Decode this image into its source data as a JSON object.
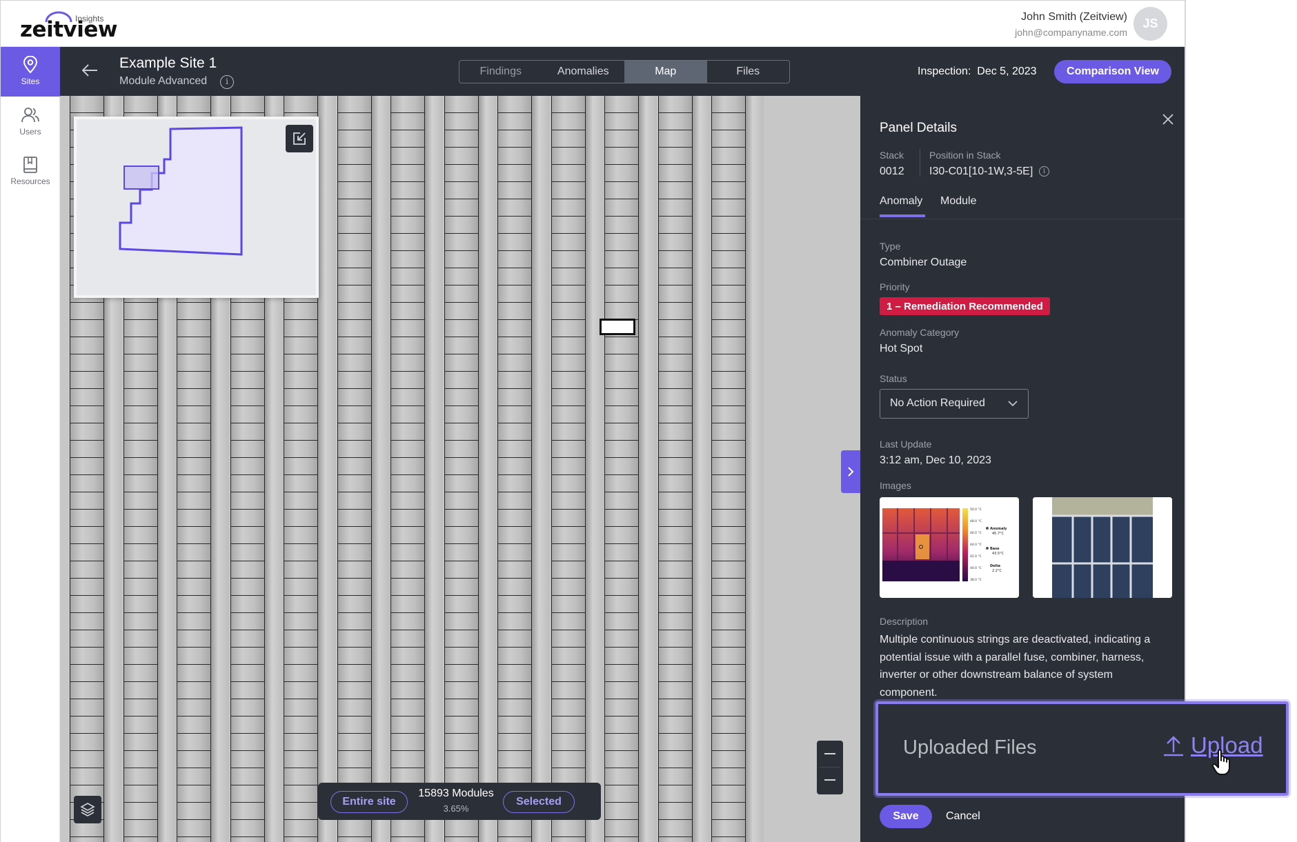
{
  "brand": {
    "name": "zeitview",
    "subtitle": "Insights"
  },
  "user": {
    "name": "John Smith (Zeitview)",
    "email": "john@companyname.com",
    "initials": "JS"
  },
  "nav": {
    "items": [
      {
        "label": "Sites",
        "icon": "location-pin-icon",
        "active": true
      },
      {
        "label": "Users",
        "icon": "users-icon",
        "active": false
      },
      {
        "label": "Resources",
        "icon": "book-icon",
        "active": false
      }
    ]
  },
  "header": {
    "site_title": "Example Site 1",
    "site_subtitle": "Module Advanced",
    "tabs": [
      {
        "label": "Findings",
        "active": false
      },
      {
        "label": "Anomalies",
        "active": false
      },
      {
        "label": "Map",
        "active": true
      },
      {
        "label": "Files",
        "active": false
      }
    ],
    "inspection_label": "Inspection:",
    "inspection_date": "Dec 5, 2023",
    "comparison_button": "Comparison View"
  },
  "map": {
    "module_count": "15893 Modules",
    "module_percent": "3.65%",
    "entire_site_label": "Entire site",
    "selected_label": "Selected"
  },
  "panel": {
    "title": "Panel Details",
    "stack_label": "Stack",
    "stack_value": "0012",
    "position_label": "Position in Stack",
    "position_value": "I30-C01[10-1W,3-5E]",
    "tabs": [
      {
        "label": "Anomaly",
        "active": true
      },
      {
        "label": "Module",
        "active": false
      }
    ],
    "type_label": "Type",
    "type_value": "Combiner Outage",
    "priority_label": "Priority",
    "priority_value": "1 – Remediation Recommended",
    "category_label": "Anomaly Category",
    "category_value": "Hot Spot",
    "status_label": "Status",
    "status_value": "No Action Required",
    "last_update_label": "Last Update",
    "last_update_value": "3:12 am, Dec 10, 2023",
    "images_label": "Images",
    "thermal_scale": [
      "50.0 °C",
      "48.0 °C",
      "46.0 °C",
      "44.0 °C",
      "42.0 °C",
      "40.0 °C",
      "38.0 °C"
    ],
    "thermal_legend": {
      "anomaly_label": "Anomaly",
      "anomaly_value": "45.7°C",
      "base_label": "Base",
      "base_value": "43.5°C",
      "delta_label": "Delta",
      "delta_value": "2.2°C"
    },
    "description_label": "Description",
    "description": "Multiple continuous strings are deactivated, indicating a potential issue with a parallel fuse, combiner, harness, inverter or other downstream balance of system component.",
    "uploaded_files_label": "Uploaded Files",
    "upload_label": "Upload",
    "save_label": "Save",
    "cancel_label": "Cancel"
  },
  "colors": {
    "accent": "#6b5ae3",
    "dark_bg": "#2b2f38",
    "priority_red": "#d01c43"
  }
}
